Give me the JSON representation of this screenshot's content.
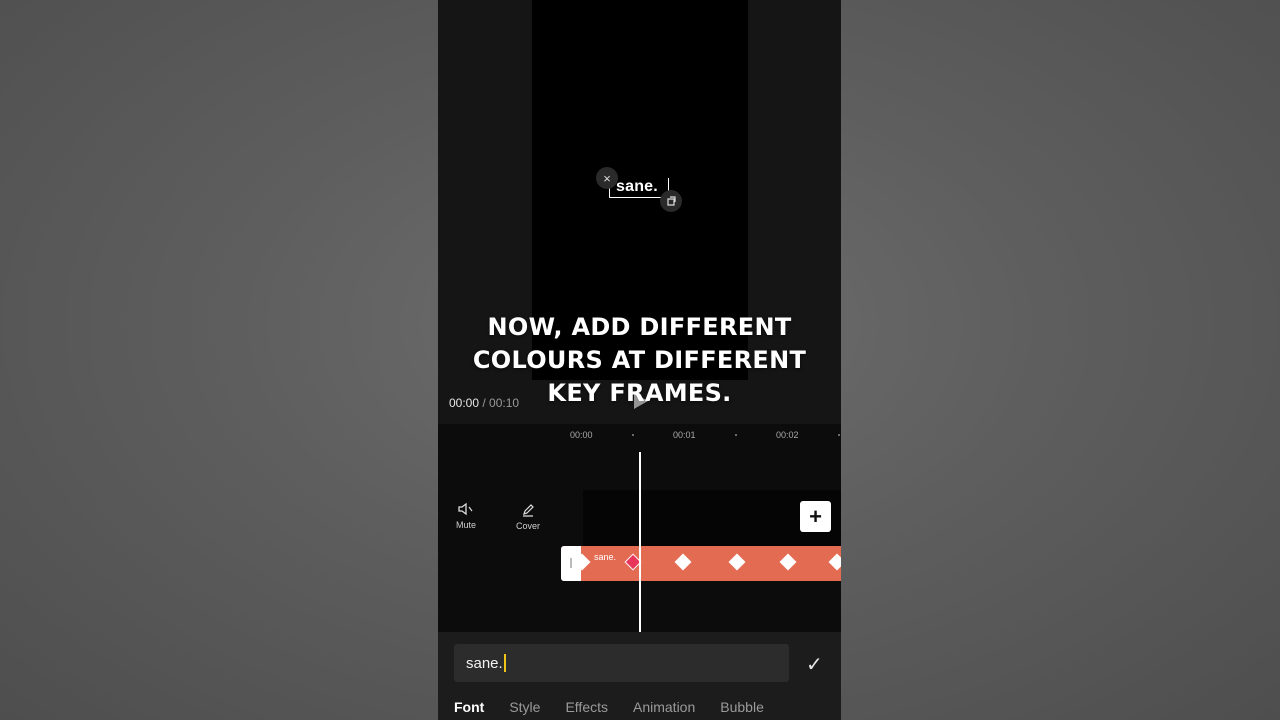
{
  "preview": {
    "text_overlay": "sane.",
    "close_icon": "×",
    "rotate_icon": "⟳"
  },
  "caption": {
    "line1": "NOW, ADD DIFFERENT",
    "line2": "COLOURS AT DIFFERENT",
    "line3": "KEY FRAMES."
  },
  "playback": {
    "current_time": "00:00",
    "separator": " / ",
    "duration": "00:10"
  },
  "timeline": {
    "ticks": [
      "00:00",
      "00:01",
      "00:02"
    ],
    "mute_label": "Mute",
    "cover_label": "Cover",
    "add_label": "+",
    "clip_label": "sane.",
    "clip_color": "#e36b52",
    "active_keyframe_color": "#e8365a"
  },
  "editor": {
    "text_value": "sane.",
    "confirm_icon": "✓",
    "tabs": [
      {
        "label": "Font",
        "active": true
      },
      {
        "label": "Style",
        "active": false
      },
      {
        "label": "Effects",
        "active": false
      },
      {
        "label": "Animation",
        "active": false
      },
      {
        "label": "Bubble",
        "active": false
      }
    ]
  }
}
